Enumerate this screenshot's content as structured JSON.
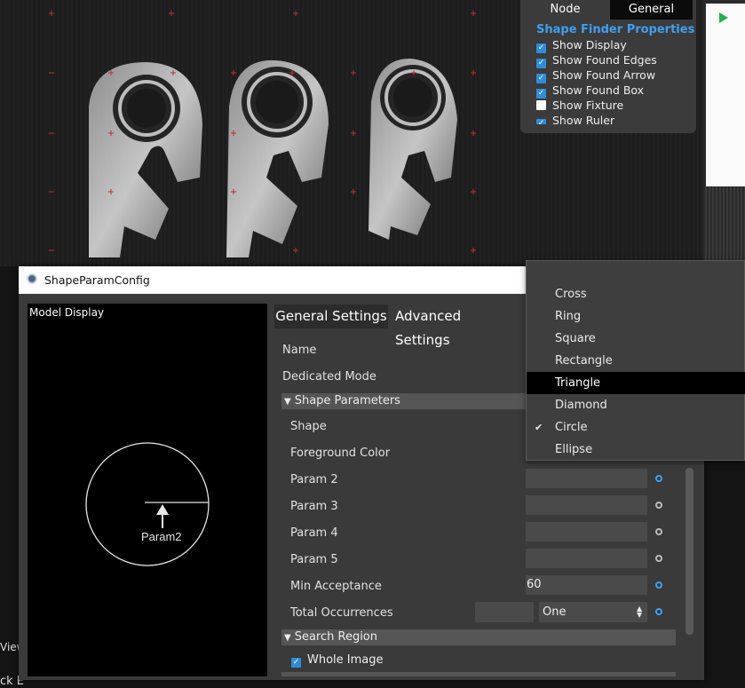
{
  "properties_panel": {
    "tabs": [
      "Node",
      "General"
    ],
    "title": "Shape Finder Properties",
    "items": [
      {
        "label": "Show Display",
        "checked": true
      },
      {
        "label": "Show Found Edges",
        "checked": true
      },
      {
        "label": "Show Found Arrow",
        "checked": true
      },
      {
        "label": "Show Found Box",
        "checked": true
      },
      {
        "label": "Show Fixture",
        "checked": false
      },
      {
        "label": "Show Ruler",
        "checked": true
      }
    ]
  },
  "background": {
    "view_label": "View",
    "bottom_label": "ck E"
  },
  "dialog": {
    "title": "ShapeParamConfig",
    "model_display": {
      "label": "Model Display",
      "param_label": "Param2"
    },
    "tabs": {
      "general": "General Settings",
      "advanced": "Advanced Settings"
    },
    "fields": {
      "name": "Name",
      "dedicated_mode": "Dedicated Mode",
      "shape_section": "Shape Parameters",
      "shape": "Shape",
      "foreground_color": "Foreground Color",
      "param2": "Param 2",
      "param3": "Param 3",
      "param4": "Param 4",
      "param5": "Param 5",
      "min_acceptance": "Min Acceptance",
      "min_acceptance_value": "60",
      "total_occurrences": "Total Occurrences",
      "total_occurrences_value": "One",
      "search_section": "Search Region",
      "whole_image": "Whole Image"
    }
  },
  "shape_dropdown": {
    "options": [
      "Cross",
      "Ring",
      "Square",
      "Rectangle",
      "Triangle",
      "Diamond",
      "Circle",
      "Ellipse"
    ],
    "highlighted": "Triangle",
    "selected": "Circle"
  },
  "colors": {
    "accent": "#3ea0f0",
    "run_green": "#22b14c",
    "fixture_mark": "#b8322f"
  }
}
